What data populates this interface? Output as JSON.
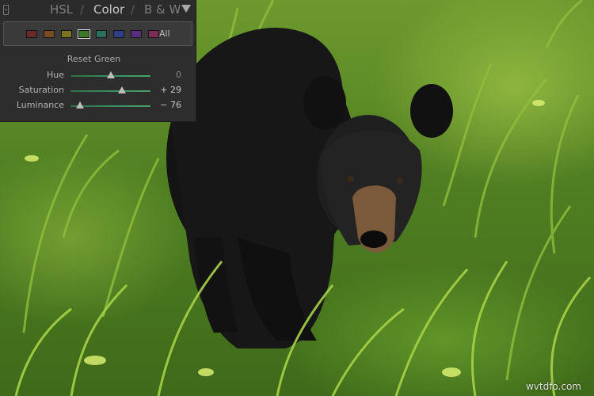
{
  "tabs": [
    {
      "label": "HSL",
      "active": false
    },
    {
      "label": "Color",
      "active": true
    },
    {
      "label": "B & W",
      "active": false
    }
  ],
  "tab_separator": "/",
  "swatches": [
    {
      "name": "red",
      "color": "#6b2a2a"
    },
    {
      "name": "orange",
      "color": "#7a4a22"
    },
    {
      "name": "yellow",
      "color": "#7a7422"
    },
    {
      "name": "green",
      "color": "#3a7a26",
      "selected": true
    },
    {
      "name": "aqua",
      "color": "#2a6e5e"
    },
    {
      "name": "blue",
      "color": "#2f3f86"
    },
    {
      "name": "purple",
      "color": "#5a2e7e"
    },
    {
      "name": "magenta",
      "color": "#7a2c56"
    }
  ],
  "all_label": "All",
  "reset_label": "Reset Green",
  "sliders": [
    {
      "label": "Hue",
      "value_text": "0",
      "value": 0,
      "min": -100,
      "max": 100
    },
    {
      "label": "Saturation",
      "value_text": "+ 29",
      "value": 29,
      "min": -100,
      "max": 100
    },
    {
      "label": "Luminance",
      "value_text": "− 76",
      "value": -76,
      "min": -100,
      "max": 100
    }
  ],
  "slider_track_color": "#3a8f5a",
  "watermark": "wvtdfo.com"
}
